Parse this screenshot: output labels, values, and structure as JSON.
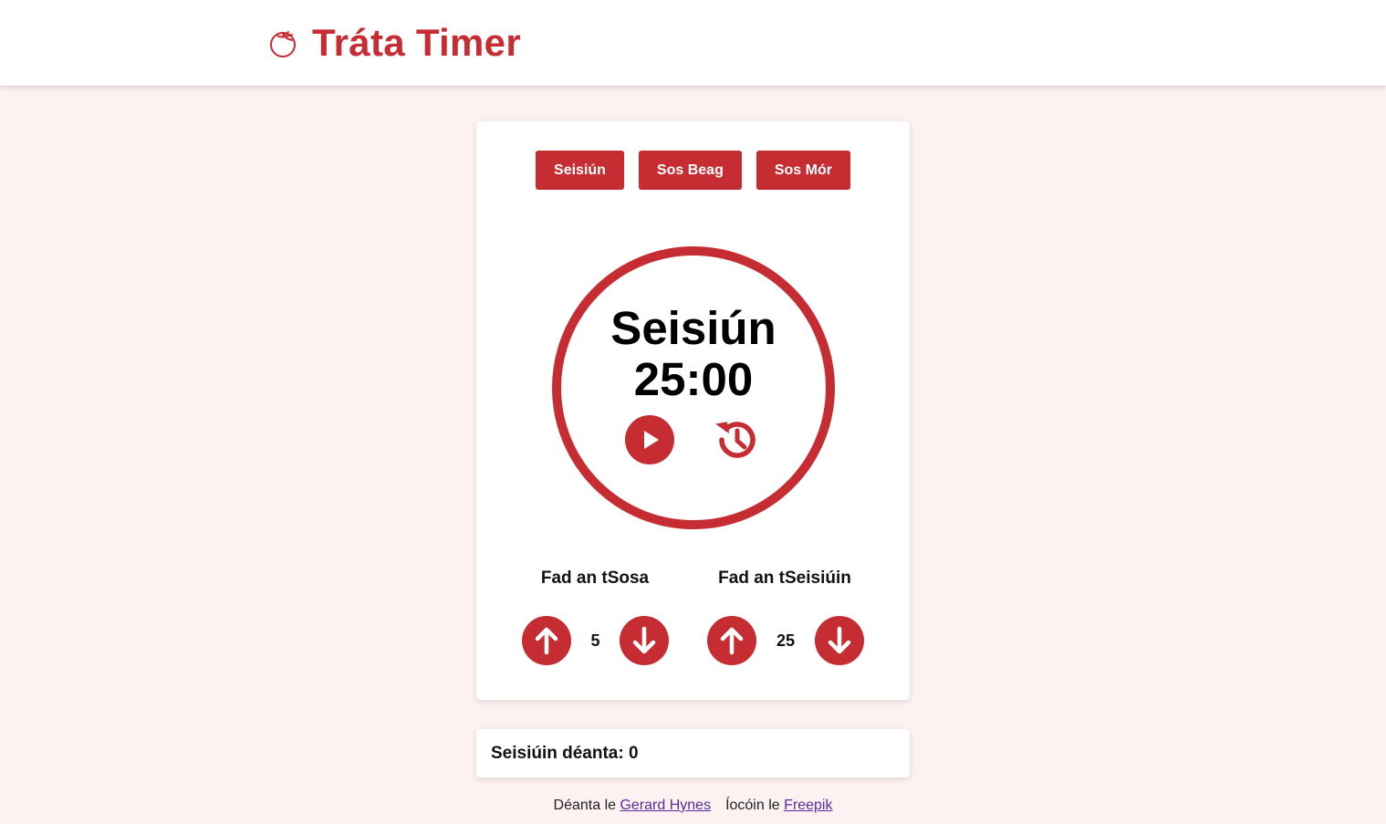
{
  "app": {
    "title": "Tráta Timer",
    "accent_color": "#c62d33",
    "background_color": "#fdf2f1",
    "logo_icon": "tomato-icon"
  },
  "modes": {
    "session": "Seisiún",
    "short_break": "Sos Beag",
    "long_break": "Sos Mór"
  },
  "timer": {
    "mode_label": "Seisiún",
    "time": "25:00",
    "play_icon": "play-icon",
    "reset_icon": "history-reset-icon"
  },
  "break_length": {
    "label": "Fad an tSosa",
    "value": "5",
    "up_icon": "arrow-up-icon",
    "down_icon": "arrow-down-icon"
  },
  "session_length": {
    "label": "Fad an tSeisiúin",
    "value": "25",
    "up_icon": "arrow-up-icon",
    "down_icon": "arrow-down-icon"
  },
  "summary": {
    "completed_text": "Seisiúin déanta: 0"
  },
  "footer": {
    "made_by_prefix": "Déanta le ",
    "made_by_link": "Gerard Hynes",
    "icons_prefix": "Íocóin le ",
    "icons_link": "Freepik"
  }
}
